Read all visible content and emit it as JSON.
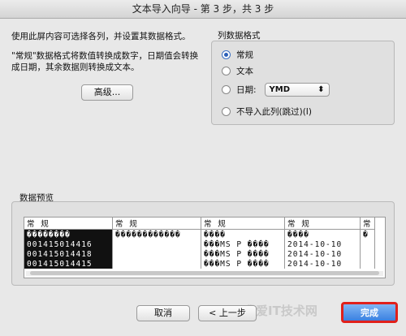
{
  "window": {
    "title": "文本导入向导 - 第 3 步，共 3 步"
  },
  "intro": {
    "line1": "使用此屏内容可选择各列，并设置其数据格式。",
    "line2": "\"常规\"数据格式将数值转换成数字，日期值会转换成日期，其余数据则转换成文本。"
  },
  "advanced_button": "高级...",
  "column_format": {
    "label": "列数据格式",
    "options": [
      "常规",
      "文本",
      "日期:",
      "不导入此列(跳过)(I)"
    ],
    "selected": "常规",
    "date_format": "YMD",
    "date_arrow": "⬍"
  },
  "preview": {
    "label": "数据预览",
    "headers": [
      "常 规",
      "常 规",
      "常 规",
      "常 规",
      "常"
    ],
    "rows": [
      [
        "��������",
        "������������",
        "����",
        "����",
        "�"
      ],
      [
        "001415014416",
        "",
        "���MS P ����",
        "2014-10-10",
        ""
      ],
      [
        "001415014418",
        "",
        "���MS P ����",
        "2014-10-10",
        ""
      ],
      [
        "001415014415",
        "",
        "���MS P ����",
        "2014-10-10",
        ""
      ]
    ]
  },
  "buttons": {
    "cancel": "取消",
    "back": "< 上一步",
    "finish": "完成"
  },
  "watermark": "我爱IT技术网"
}
